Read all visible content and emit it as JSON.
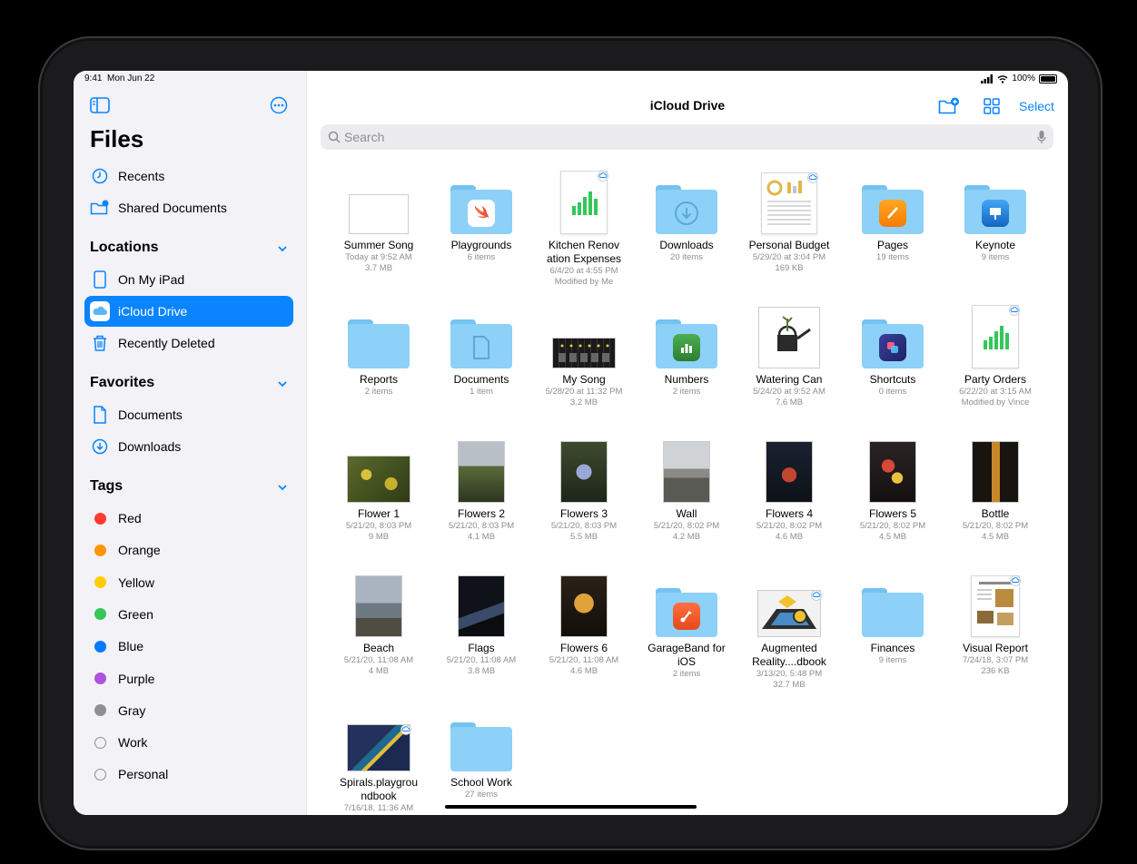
{
  "status": {
    "time": "9:41",
    "date": "Mon Jun 22",
    "battery": "100%"
  },
  "sidebar": {
    "title": "Files",
    "top_items": [
      {
        "label": "Recents",
        "icon": "clock-icon"
      },
      {
        "label": "Shared Documents",
        "icon": "shared-folder-icon"
      }
    ],
    "locations_header": "Locations",
    "locations": [
      {
        "label": "On My iPad",
        "icon": "ipad-icon"
      },
      {
        "label": "iCloud Drive",
        "icon": "icloud-icon",
        "selected": true
      },
      {
        "label": "Recently Deleted",
        "icon": "trash-icon"
      }
    ],
    "favorites_header": "Favorites",
    "favorites": [
      {
        "label": "Documents",
        "icon": "document-icon"
      },
      {
        "label": "Downloads",
        "icon": "download-icon"
      }
    ],
    "tags_header": "Tags",
    "tags": [
      {
        "label": "Red",
        "color": "#ff3b30"
      },
      {
        "label": "Orange",
        "color": "#ff9500"
      },
      {
        "label": "Yellow",
        "color": "#ffcc00"
      },
      {
        "label": "Green",
        "color": "#34c759"
      },
      {
        "label": "Blue",
        "color": "#007aff"
      },
      {
        "label": "Purple",
        "color": "#af52de"
      },
      {
        "label": "Gray",
        "color": "#8e8e93"
      },
      {
        "label": "Work",
        "color": ""
      },
      {
        "label": "Personal",
        "color": ""
      }
    ]
  },
  "main": {
    "title": "iCloud Drive",
    "select_label": "Select",
    "search_placeholder": "Search",
    "accent": "#0a84ff",
    "items": [
      {
        "name": "Summer Song",
        "meta1": "Today at 9:52 AM",
        "meta2": "3.7 MB",
        "meta3": "",
        "kind": "photo",
        "art": "garageband"
      },
      {
        "name": "Playgrounds",
        "meta1": "6 items",
        "meta2": "",
        "meta3": "",
        "kind": "folder",
        "badge": "swift"
      },
      {
        "name": "Kitchen Renov\nation Expenses",
        "meta1": "6/4/20 at 4:55 PM",
        "meta2": "Modified by Me",
        "meta3": "",
        "kind": "doc",
        "art": "numbers",
        "cloud": true
      },
      {
        "name": "Downloads",
        "meta1": "20 items",
        "meta2": "",
        "meta3": "",
        "kind": "folder",
        "badge": "download"
      },
      {
        "name": "Personal Budget",
        "meta1": "5/29/20 at 3:04 PM",
        "meta2": "169 KB",
        "meta3": "",
        "kind": "doc",
        "art": "budget",
        "cloud": true
      },
      {
        "name": "Pages",
        "meta1": "19 items",
        "meta2": "",
        "meta3": "",
        "kind": "folder",
        "badge": "pages"
      },
      {
        "name": "Keynote",
        "meta1": "9 items",
        "meta2": "",
        "meta3": "",
        "kind": "folder",
        "badge": "keynote"
      },
      {
        "name": "Reports",
        "meta1": "2 items",
        "meta2": "",
        "meta3": "",
        "kind": "folder",
        "badge": ""
      },
      {
        "name": "Documents",
        "meta1": "1 item",
        "meta2": "",
        "meta3": "",
        "kind": "folder",
        "badge": "document"
      },
      {
        "name": "My Song",
        "meta1": "5/28/20 at 11:32 PM",
        "meta2": "3.2 MB",
        "meta3": "",
        "kind": "photo",
        "art": "mysong"
      },
      {
        "name": "Numbers",
        "meta1": "2 items",
        "meta2": "",
        "meta3": "",
        "kind": "folder",
        "badge": "numbers"
      },
      {
        "name": "Watering Can",
        "meta1": "5/24/20 at 9:52 AM",
        "meta2": "7.6 MB",
        "meta3": "",
        "kind": "photo",
        "art": "wateringcan"
      },
      {
        "name": "Shortcuts",
        "meta1": "0 items",
        "meta2": "",
        "meta3": "",
        "kind": "folder",
        "badge": "shortcuts"
      },
      {
        "name": "Party Orders",
        "meta1": "6/22/20 at 3:15 AM",
        "meta2": "Modified by Vince",
        "meta3": "",
        "kind": "doc",
        "art": "numbers",
        "cloud": true
      },
      {
        "name": "Flower 1",
        "meta1": "5/21/20, 8:03 PM",
        "meta2": "9 MB",
        "meta3": "",
        "kind": "photo",
        "art": "flower1"
      },
      {
        "name": "Flowers 2",
        "meta1": "5/21/20, 8:03 PM",
        "meta2": "4.1 MB",
        "meta3": "",
        "kind": "photo",
        "art": "flowers2"
      },
      {
        "name": "Flowers 3",
        "meta1": "5/21/20, 8:03 PM",
        "meta2": "5.5 MB",
        "meta3": "",
        "kind": "photo",
        "art": "flowers3"
      },
      {
        "name": "Wall",
        "meta1": "5/21/20, 8:02 PM",
        "meta2": "4.2 MB",
        "meta3": "",
        "kind": "photo",
        "art": "wall"
      },
      {
        "name": "Flowers 4",
        "meta1": "5/21/20, 8:02 PM",
        "meta2": "4.6 MB",
        "meta3": "",
        "kind": "photo",
        "art": "flowers4"
      },
      {
        "name": "Flowers 5",
        "meta1": "5/21/20, 8:02 PM",
        "meta2": "4.5 MB",
        "meta3": "",
        "kind": "photo",
        "art": "flowers5"
      },
      {
        "name": "Bottle",
        "meta1": "5/21/20, 8:02 PM",
        "meta2": "4.5 MB",
        "meta3": "",
        "kind": "photo",
        "art": "bottle"
      },
      {
        "name": "Beach",
        "meta1": "5/21/20, 11:08 AM",
        "meta2": "4 MB",
        "meta3": "",
        "kind": "photo",
        "art": "beach"
      },
      {
        "name": "Flags",
        "meta1": "5/21/20, 11:08 AM",
        "meta2": "3.8 MB",
        "meta3": "",
        "kind": "photo",
        "art": "flags"
      },
      {
        "name": "Flowers 6",
        "meta1": "5/21/20, 11:08 AM",
        "meta2": "4.6 MB",
        "meta3": "",
        "kind": "photo",
        "art": "flowers6"
      },
      {
        "name": "GarageBand for\niOS",
        "meta1": "2 items",
        "meta2": "",
        "meta3": "",
        "kind": "folder",
        "badge": "garageband"
      },
      {
        "name": "Augmented\nReality....dbook",
        "meta1": "3/13/20, 5:48 PM",
        "meta2": "32.7 MB",
        "meta3": "",
        "kind": "photo",
        "art": "augmented",
        "cloud": true
      },
      {
        "name": "Finances",
        "meta1": "9 items",
        "meta2": "",
        "meta3": "",
        "kind": "folder",
        "badge": ""
      },
      {
        "name": "Visual Report",
        "meta1": "7/24/18, 3:07 PM",
        "meta2": "236 KB",
        "meta3": "",
        "kind": "doc",
        "art": "visualreport",
        "cloud": true
      },
      {
        "name": "Spirals.playgrou\nndbook",
        "meta1": "7/16/18, 11:36 AM",
        "meta2": "",
        "meta3": "",
        "kind": "photo",
        "art": "spirals",
        "cloud": true
      },
      {
        "name": "School Work",
        "meta1": "27 items",
        "meta2": "",
        "meta3": "",
        "kind": "folder",
        "badge": ""
      }
    ]
  }
}
